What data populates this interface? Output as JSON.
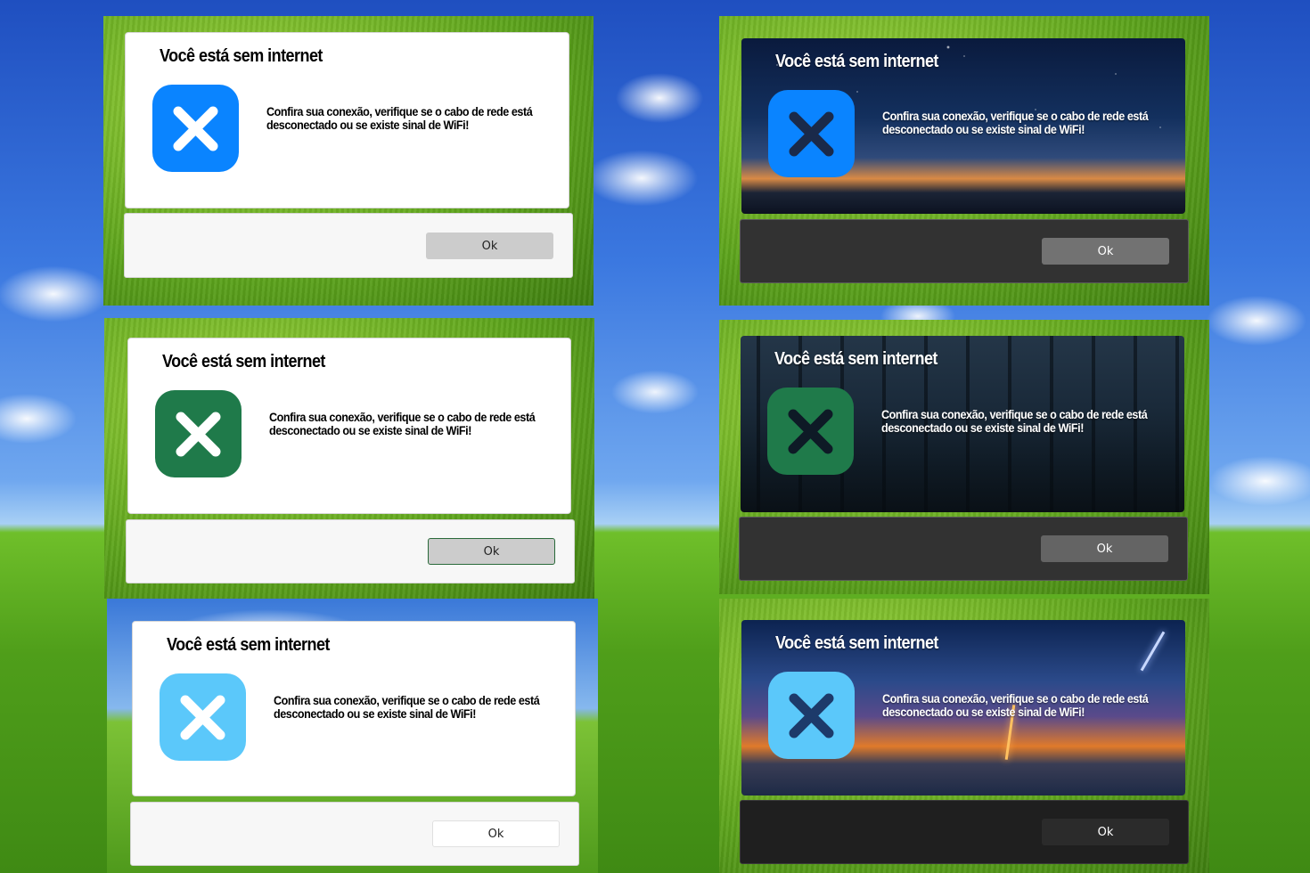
{
  "dialog": {
    "title": "Você está sem internet",
    "message_line1": "Confira sua conexão, verifique se o cabo de rede está",
    "message_line2": "desconectado ou se existe sinal de WiFi!",
    "ok_label": "Ok"
  },
  "variants": [
    {
      "id": "light-blue",
      "theme": "light",
      "icon_color": "#0a84ff",
      "x_color": "#ffffff"
    },
    {
      "id": "night-blue",
      "theme": "night-sky",
      "icon_color": "#0a84ff",
      "x_color": "#1a2a4a"
    },
    {
      "id": "light-green",
      "theme": "light",
      "icon_color": "#1f7a4a",
      "x_color": "#ffffff"
    },
    {
      "id": "forest-green",
      "theme": "dark-forest",
      "icon_color": "#1f7a4a",
      "x_color": "#0e1a26"
    },
    {
      "id": "light-sky",
      "theme": "light",
      "icon_color": "#5bc8fa",
      "x_color": "#ffffff"
    },
    {
      "id": "storm-sky",
      "theme": "storm",
      "icon_color": "#5bc8fa",
      "x_color": "#1d3a6a"
    }
  ],
  "icons": {
    "error": "close-x-icon"
  }
}
